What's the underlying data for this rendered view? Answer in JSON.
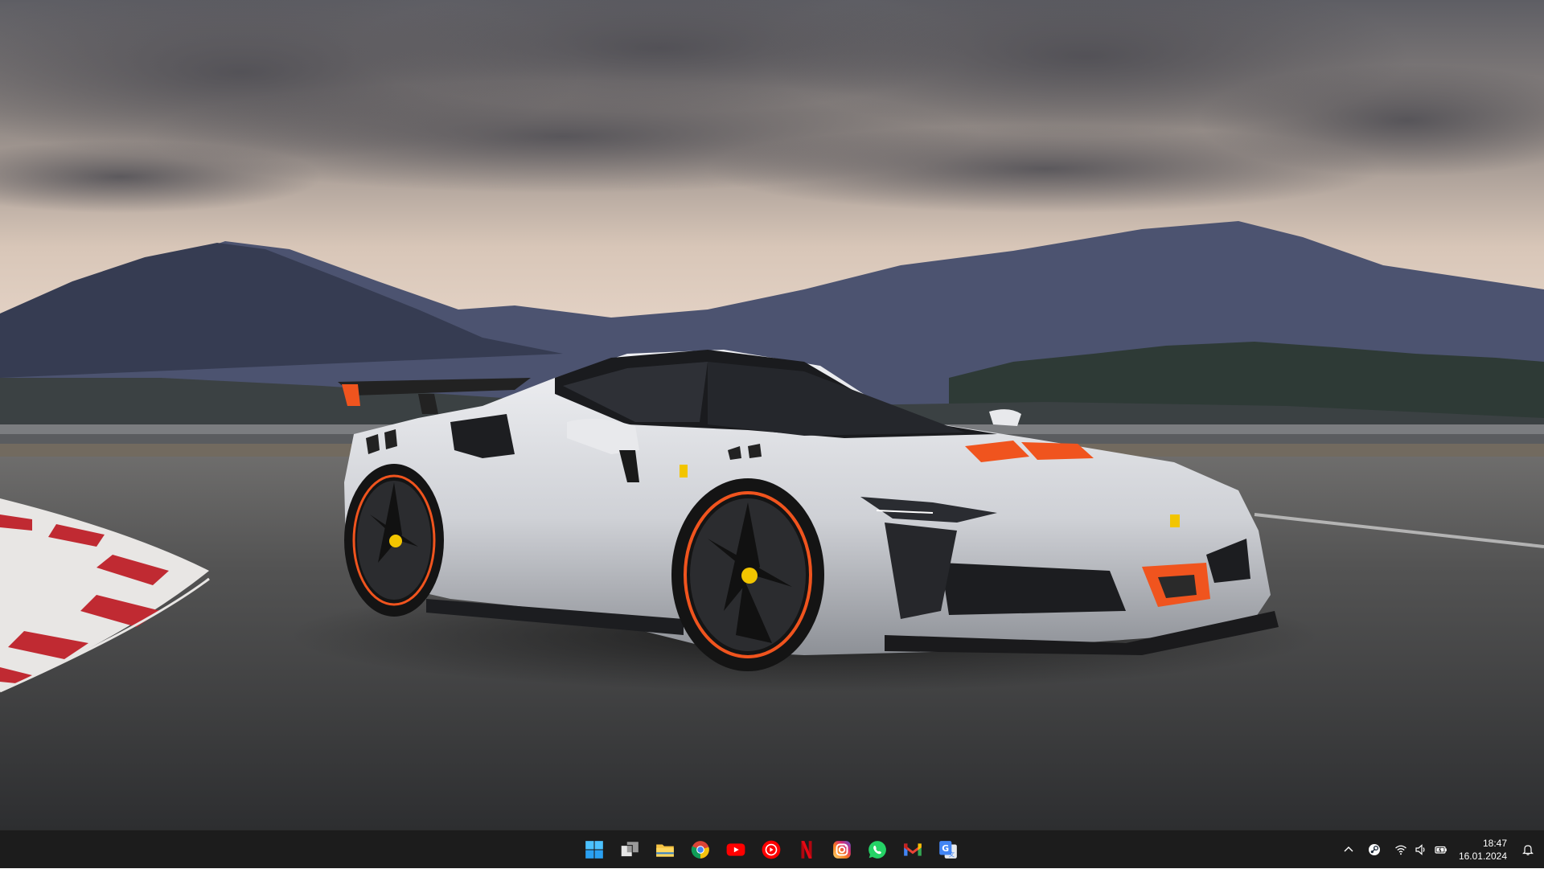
{
  "wallpaper": {
    "subject": "white Ferrari sports car on race track with mountains at dusk",
    "colors": {
      "sky_top": "#6b6a6e",
      "sky_horizon": "#e4d2c4",
      "mountains_far": "#4d5470",
      "mountains_near": "#2e3447",
      "track": "#3f4042",
      "car_body": "#d9dadf",
      "car_roof": "#1a1b1e",
      "accent_orange": "#f0541e",
      "kerb_red": "#c02a32"
    }
  },
  "taskbar": {
    "background": "#1c1c1c",
    "apps": [
      {
        "name": "start",
        "icon": "windows-logo-icon",
        "color": "#3aa0f5"
      },
      {
        "name": "task-view",
        "icon": "task-view-icon",
        "color": "#e6e6e6"
      },
      {
        "name": "file-explorer",
        "icon": "folder-icon",
        "color": "#f6c343"
      },
      {
        "name": "chrome",
        "icon": "chrome-icon",
        "color": "#4285f4"
      },
      {
        "name": "youtube",
        "icon": "youtube-icon",
        "color": "#ff0000"
      },
      {
        "name": "youtube-music",
        "icon": "youtube-music-icon",
        "color": "#ff0000"
      },
      {
        "name": "netflix",
        "icon": "netflix-icon",
        "color": "#e50914"
      },
      {
        "name": "instagram",
        "icon": "instagram-icon",
        "color": "#d62976"
      },
      {
        "name": "whatsapp",
        "icon": "whatsapp-icon",
        "color": "#25d366"
      },
      {
        "name": "gmail",
        "icon": "gmail-icon",
        "color": "#ea4335"
      },
      {
        "name": "google-translate",
        "icon": "translate-icon",
        "color": "#4285f4"
      }
    ],
    "tray": {
      "icons": [
        "chevron-up-icon",
        "steam-icon",
        "wifi-icon",
        "speaker-icon",
        "battery-icon"
      ],
      "time": "18:47",
      "date": "16.01.2024",
      "notification_icon": "bell-icon"
    }
  }
}
